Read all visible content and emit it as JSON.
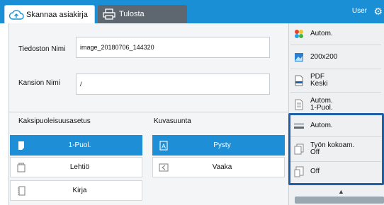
{
  "tabs": {
    "scan_label": "Skannaa asiakirja",
    "print_label": "Tulosta"
  },
  "header": {
    "user": "User"
  },
  "fields": {
    "file_name_label": "Tiedoston Nimi",
    "file_name_value": "image_20180706_144320",
    "folder_name_label": "Kansion Nimi",
    "folder_name_value": "/"
  },
  "duplex": {
    "title": "Kaksipuoleisuusasetus",
    "options": [
      "1-Puol.",
      "Lehtiö",
      "Kirja"
    ],
    "selected": "1-Puol."
  },
  "orientation": {
    "title": "Kuvasuunta",
    "options": [
      "Pysty",
      "Vaaka"
    ],
    "selected": "Pysty"
  },
  "sidebar": {
    "color": "Autom.",
    "resolution": "200x200",
    "format_line1": "PDF",
    "format_line2": "Keski",
    "duplex_line1": "Autom.",
    "duplex_line2": "1-Puol.",
    "density": "Autom.",
    "job_build_line1": "Työn kokoam.",
    "job_build_line2": "Off",
    "mixed": "Off"
  },
  "colors": {
    "topbar": "#1b8fd6",
    "selected": "#1e8fd6",
    "highlight": "#1f5fa8"
  }
}
